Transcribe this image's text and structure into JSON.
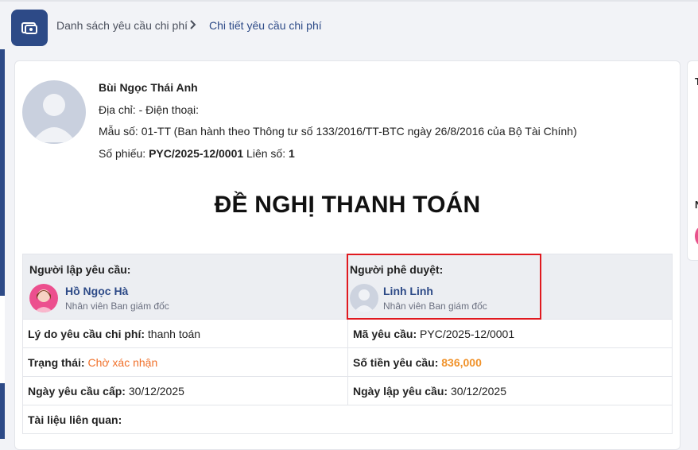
{
  "breadcrumb": {
    "parent": "Danh sách yêu cầu chi phí",
    "current": "Chi tiết yêu cầu chi phí"
  },
  "company": {
    "name": "Bùi Ngọc Thái Anh",
    "address_line": "Địa chỉ: - Điện thoại:",
    "form_line": "Mẫu số: 01-TT (Ban hành theo Thông tư số 133/2016/TT-BTC ngày 26/8/2016 của Bộ Tài Chính)",
    "voucher_label": "Số phiếu:",
    "voucher_no": "PYC/2025-12/0001",
    "copy_label": "Liên số:",
    "copy_no": "1"
  },
  "document_title": "ĐỀ NGHỊ THANH TOÁN",
  "requester": {
    "label": "Người lập yêu cầu:",
    "name": "Hồ Ngọc Hà",
    "role": "Nhân viên Ban giám đốc"
  },
  "approver": {
    "label": "Người phê duyệt:",
    "name": "Linh Linh",
    "role": "Nhân viên Ban giám đốc"
  },
  "fields": {
    "reason_label": "Lý do yêu cầu chi phí:",
    "reason_value": "thanh toán",
    "code_label": "Mã yêu cầu:",
    "code_value": "PYC/2025-12/0001",
    "status_label": "Trạng thái:",
    "status_value": "Chờ xác nhận",
    "amount_label": "Số tiền yêu cầu:",
    "amount_value": "836,000",
    "issue_date_label": "Ngày yêu cầu cấp:",
    "issue_date_value": "30/12/2025",
    "created_date_label": "Ngày lập yêu cầu:",
    "created_date_value": "30/12/2025",
    "attachments_label": "Tài liệu liên quan:"
  },
  "right_panel": {
    "heading1": "T",
    "heading2": "N"
  },
  "colors": {
    "brand": "#2d4a87",
    "status": "#f0702a",
    "amount": "#f0922a",
    "highlight": "#e0191f"
  }
}
